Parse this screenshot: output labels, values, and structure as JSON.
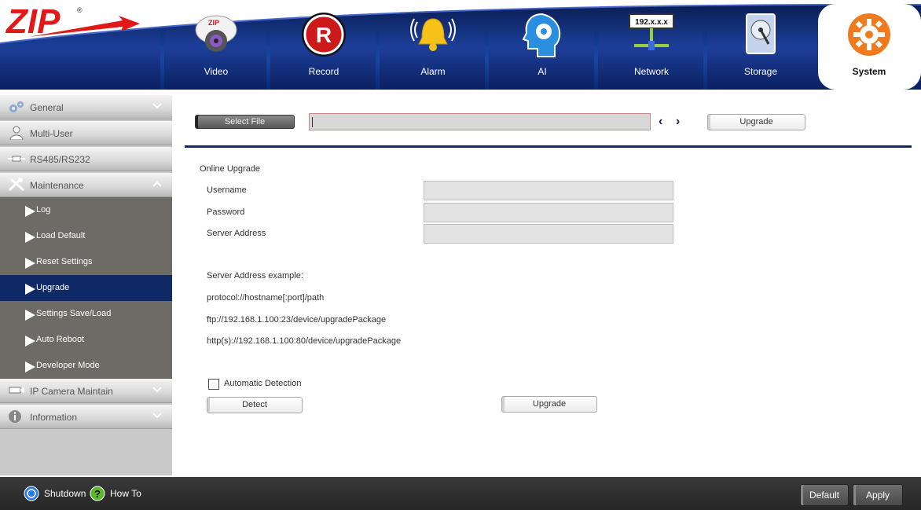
{
  "brand": {
    "logo_text": "ZIP",
    "registered": "®"
  },
  "nav": {
    "tabs": [
      {
        "label": "Video",
        "icon": "camera-icon"
      },
      {
        "label": "Record",
        "icon": "record-icon",
        "icon_text": "R"
      },
      {
        "label": "Alarm",
        "icon": "alarm-bell-icon"
      },
      {
        "label": "AI",
        "icon": "ai-head-icon"
      },
      {
        "label": "Network",
        "icon": "network-icon",
        "icon_text": "192.x.x.x"
      },
      {
        "label": "Storage",
        "icon": "hard-drive-icon"
      },
      {
        "label": "System",
        "icon": "system-gear-icon",
        "active": true
      }
    ]
  },
  "sidebar": {
    "items": [
      {
        "label": "General",
        "icon": "gears-icon",
        "expanded": false
      },
      {
        "label": "Multi-User",
        "icon": "user-icon"
      },
      {
        "label": "RS485/RS232",
        "icon": "serial-cable-icon"
      },
      {
        "label": "Maintenance",
        "icon": "tools-icon",
        "expanded": true
      }
    ],
    "maintenance_sub": [
      {
        "label": "Log"
      },
      {
        "label": "Load Default"
      },
      {
        "label": "Reset Settings"
      },
      {
        "label": "Upgrade",
        "active": true
      },
      {
        "label": "Settings Save/Load"
      },
      {
        "label": "Auto Reboot"
      },
      {
        "label": "Developer Mode"
      }
    ],
    "tail_items": [
      {
        "label": "IP Camera Maintain",
        "icon": "ip-camera-icon",
        "expanded": false
      },
      {
        "label": "Information",
        "icon": "info-icon",
        "expanded": false
      }
    ]
  },
  "file_upgrade": {
    "select_file_label": "Select File",
    "file_path_value": "",
    "upgrade_label": "Upgrade"
  },
  "online_upgrade": {
    "title": "Online Upgrade",
    "username_label": "Username",
    "username_value": "",
    "password_label": "Password",
    "password_value": "",
    "server_label": "Server Address",
    "server_value": "",
    "example_title": "Server Address example:",
    "example_lines": [
      "protocol://hostname[:port]/path",
      "ftp://192.168.1.100:23/device/upgradePackage",
      "http(s)://192.168.1.100:80/device/upgradePackage"
    ],
    "auto_detect_label": "Automatic Detection",
    "auto_detect_checked": false,
    "detect_label": "Detect",
    "upgrade_label": "Upgrade"
  },
  "footer": {
    "shutdown_label": "Shutdown",
    "howto_label": "How To",
    "default_label": "Default",
    "apply_label": "Apply"
  },
  "colors": {
    "header_blue": "#0c2a74",
    "active_sub_bg": "#0f2a66",
    "sub_bg": "#6e6a66",
    "accent_orange": "#f07a1e",
    "record_red": "#cc1a1a"
  }
}
